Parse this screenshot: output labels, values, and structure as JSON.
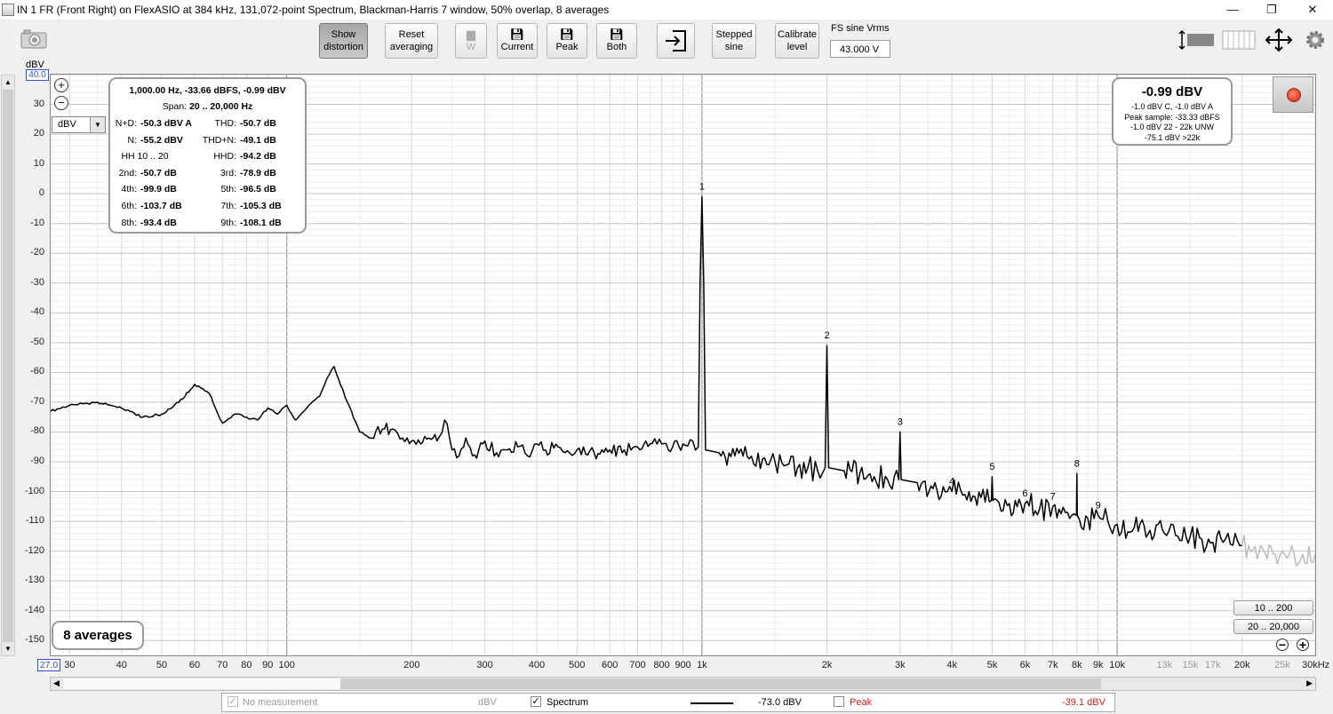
{
  "window": {
    "title": "IN 1 FR (Front Right) on FlexASIO at 384 kHz, 131,072-point Spectrum, Blackman-Harris 7 window, 50% overlap, 8 averages",
    "minimize": "—",
    "restore": "❐",
    "close": "✕"
  },
  "toolbar": {
    "show_distortion": [
      "Show",
      "distortion"
    ],
    "reset_averaging": [
      "Reset",
      "averaging"
    ],
    "w_label": "W",
    "current_label": "Current",
    "peak_label": "Peak",
    "both_label": "Both",
    "stepped_sine": [
      "Stepped",
      "sine"
    ],
    "calibrate_level": [
      "Calibrate",
      "level"
    ],
    "fs_sine_label": "FS sine Vrms",
    "fs_sine_value": "43.000 V"
  },
  "axes": {
    "y_unit": "dBV",
    "y_top_value": "40.0",
    "y_ticks": [
      "30",
      "20",
      "10",
      "0",
      "-10",
      "-20",
      "-30",
      "-40",
      "-50",
      "-60",
      "-70",
      "-80",
      "-90",
      "-100",
      "-110",
      "-120",
      "-130",
      "-140",
      "-150"
    ],
    "x_start_value": "27.0",
    "x_ticks": [
      "30",
      "40",
      "50",
      "60",
      "70",
      "80",
      "90",
      "100",
      "200",
      "300",
      "400",
      "500",
      "600",
      "700",
      "800",
      "900",
      "1k",
      "2k",
      "3k",
      "4k",
      "5k",
      "6k",
      "7k",
      "8k",
      "9k",
      "10k",
      "13k",
      "15k",
      "17k",
      "20k",
      "25k",
      "30kHz"
    ],
    "unit_select": "dBV"
  },
  "distortion_panel": {
    "header": "1,000.00 Hz, -33.66 dBFS, -0.99 dBV",
    "span_label": "Span:",
    "span_value": "20 .. 20,000 Hz",
    "rows": [
      {
        "l1": "N+D:",
        "v1": "-50.3 dBV A",
        "l2": "THD:",
        "v2": "-50.7 dB"
      },
      {
        "l1": "N:",
        "v1": "-55.2 dBV",
        "l2": "THD+N:",
        "v2": "-49.1 dB"
      },
      {
        "l1": "HH 10 .. 20",
        "v1": "",
        "l2": "HHD:",
        "v2": "-94.2 dB"
      },
      {
        "l1": "2nd:",
        "v1": "-50.7 dB",
        "l2": "3rd:",
        "v2": "-78.9 dB"
      },
      {
        "l1": "4th:",
        "v1": "-99.9 dB",
        "l2": "5th:",
        "v2": "-96.5 dB"
      },
      {
        "l1": "6th:",
        "v1": "-103.7 dB",
        "l2": "7th:",
        "v2": "-105.3 dB"
      },
      {
        "l1": "8th:",
        "v1": "-93.4 dB",
        "l2": "9th:",
        "v2": "-108.1 dB"
      }
    ]
  },
  "level_panel": {
    "main": "-0.99 dBV",
    "lines": [
      "-1.0 dBV C, -1.0 dBV A",
      "Peak sample: -33.33 dBFS",
      "-1.0 dBV 22 - 22k UNW",
      "-75.1 dBV >22k"
    ]
  },
  "averages_label": "8 averages",
  "zoom": {
    "range1": "10 .. 200",
    "range2": "20 .. 20,000"
  },
  "harmonics": [
    {
      "n": "1",
      "freq": 1000,
      "db": -1
    },
    {
      "n": "2",
      "freq": 2000,
      "db": -51
    },
    {
      "n": "3",
      "freq": 3000,
      "db": -80
    },
    {
      "n": "4",
      "freq": 4000,
      "db": -100
    },
    {
      "n": "5",
      "freq": 5000,
      "db": -95
    },
    {
      "n": "6",
      "freq": 6000,
      "db": -104
    },
    {
      "n": "7",
      "freq": 7000,
      "db": -105
    },
    {
      "n": "8",
      "freq": 8000,
      "db": -94
    },
    {
      "n": "9",
      "freq": 9000,
      "db": -108
    }
  ],
  "legend": {
    "no_measurement": "No measurement",
    "no_measurement_unit": "dBV",
    "spectrum": "Spectrum",
    "spectrum_value": "-73.0 dBV",
    "peak": "Peak",
    "peak_value": "-39.1 dBV"
  },
  "chart_data": {
    "type": "line",
    "title": "",
    "xlabel": "",
    "ylabel": "dBV",
    "x_scale": "log",
    "xlim": [
      27,
      30000
    ],
    "ylim": [
      -155,
      40
    ],
    "grid": true,
    "series": [
      {
        "name": "Spectrum",
        "color": "#000000",
        "points": [
          [
            27,
            -73
          ],
          [
            30,
            -71
          ],
          [
            35,
            -70
          ],
          [
            40,
            -72
          ],
          [
            45,
            -75
          ],
          [
            50,
            -74
          ],
          [
            55,
            -70
          ],
          [
            60,
            -64
          ],
          [
            65,
            -67
          ],
          [
            70,
            -77
          ],
          [
            75,
            -74
          ],
          [
            80,
            -75
          ],
          [
            85,
            -76
          ],
          [
            90,
            -72
          ],
          [
            95,
            -74
          ],
          [
            100,
            -71
          ],
          [
            105,
            -76
          ],
          [
            110,
            -73
          ],
          [
            120,
            -68
          ],
          [
            125,
            -62
          ],
          [
            130,
            -58
          ],
          [
            140,
            -70
          ],
          [
            150,
            -80
          ],
          [
            160,
            -82
          ],
          [
            170,
            -79
          ],
          [
            180,
            -79
          ],
          [
            190,
            -82
          ],
          [
            200,
            -83
          ],
          [
            210,
            -84
          ],
          [
            220,
            -82
          ],
          [
            230,
            -83
          ],
          [
            240,
            -76
          ],
          [
            250,
            -86
          ],
          [
            260,
            -88
          ],
          [
            270,
            -82
          ],
          [
            280,
            -88
          ],
          [
            290,
            -86
          ],
          [
            300,
            -83
          ],
          [
            320,
            -87
          ],
          [
            340,
            -86
          ],
          [
            360,
            -85
          ],
          [
            380,
            -88
          ],
          [
            400,
            -84
          ],
          [
            420,
            -86
          ],
          [
            450,
            -85
          ],
          [
            480,
            -87
          ],
          [
            500,
            -86
          ],
          [
            550,
            -87
          ],
          [
            600,
            -86
          ],
          [
            650,
            -86
          ],
          [
            700,
            -85
          ],
          [
            750,
            -84
          ],
          [
            800,
            -84
          ],
          [
            850,
            -85
          ],
          [
            900,
            -84
          ],
          [
            950,
            -83
          ],
          [
            980,
            -85
          ],
          [
            990,
            -30
          ],
          [
            1000,
            -1
          ],
          [
            1010,
            -30
          ],
          [
            1020,
            -86
          ],
          [
            1100,
            -87
          ],
          [
            1200,
            -88
          ],
          [
            1300,
            -89
          ],
          [
            1400,
            -89
          ],
          [
            1500,
            -90
          ],
          [
            1600,
            -91
          ],
          [
            1700,
            -92
          ],
          [
            1800,
            -92
          ],
          [
            1900,
            -93
          ],
          [
            1980,
            -92
          ],
          [
            2000,
            -51
          ],
          [
            2020,
            -92
          ],
          [
            2200,
            -93
          ],
          [
            2400,
            -94
          ],
          [
            2600,
            -95
          ],
          [
            2800,
            -96
          ],
          [
            2980,
            -96
          ],
          [
            3000,
            -80
          ],
          [
            3020,
            -96
          ],
          [
            3300,
            -97
          ],
          [
            3600,
            -99
          ],
          [
            3900,
            -100
          ],
          [
            4000,
            -100
          ],
          [
            4300,
            -101
          ],
          [
            4700,
            -102
          ],
          [
            4980,
            -103
          ],
          [
            5000,
            -95
          ],
          [
            5020,
            -103
          ],
          [
            5500,
            -104
          ],
          [
            6000,
            -104
          ],
          [
            6500,
            -106
          ],
          [
            7000,
            -105
          ],
          [
            7500,
            -107
          ],
          [
            7980,
            -108
          ],
          [
            8000,
            -94
          ],
          [
            8020,
            -108
          ],
          [
            8500,
            -109
          ],
          [
            9000,
            -108
          ],
          [
            9500,
            -110
          ],
          [
            10000,
            -111
          ],
          [
            11000,
            -112
          ],
          [
            12000,
            -113
          ],
          [
            13000,
            -114
          ],
          [
            14000,
            -115
          ],
          [
            15000,
            -115
          ],
          [
            16000,
            -116
          ],
          [
            17000,
            -117
          ],
          [
            18000,
            -117
          ],
          [
            19000,
            -118
          ],
          [
            20000,
            -118
          ]
        ]
      },
      {
        "name": "Out of band",
        "color": "#bbbbbb",
        "points": [
          [
            20000,
            -118
          ],
          [
            22000,
            -120
          ],
          [
            24000,
            -121
          ],
          [
            25000,
            -120
          ],
          [
            26000,
            -121
          ],
          [
            28000,
            -121
          ],
          [
            30000,
            -121
          ]
        ]
      }
    ]
  }
}
